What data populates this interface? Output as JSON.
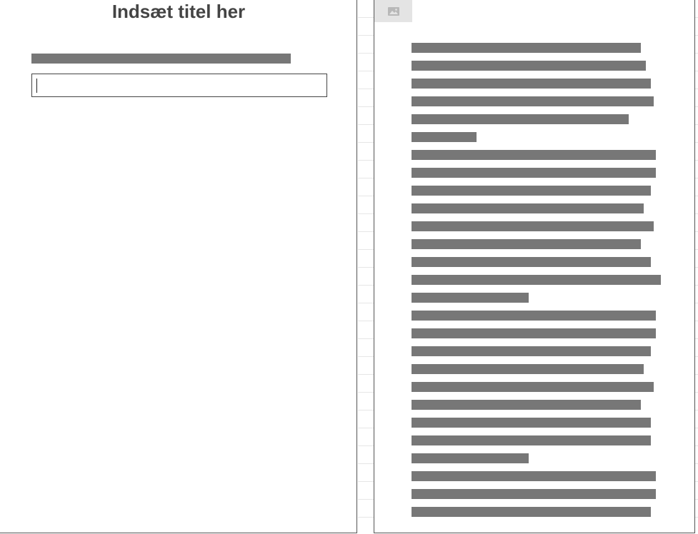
{
  "editor": {
    "title": "Indsæt titel her",
    "input_value": "",
    "input_placeholder": ""
  },
  "document": {
    "image_icon": "image-icon",
    "line_lengths": [
      0.92,
      0.94,
      0.96,
      0.97,
      0.87,
      0.26,
      0.98,
      0.98,
      0.96,
      0.93,
      0.97,
      0.92,
      0.96,
      1.0,
      0.47,
      0.98,
      0.98,
      0.96,
      0.93,
      0.97,
      0.92,
      0.96,
      0.96,
      0.47,
      0.98,
      0.98,
      0.96
    ]
  },
  "colors": {
    "bar": "#777777",
    "title": "#444444",
    "placeholder_bg": "#e4e4e4"
  }
}
